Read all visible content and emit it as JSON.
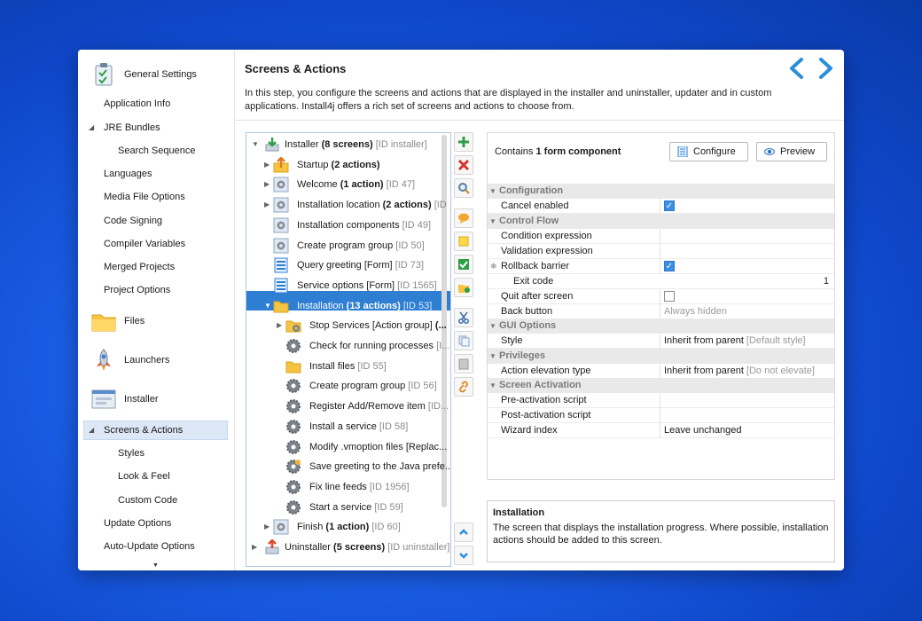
{
  "header": {
    "title": "Screens & Actions",
    "description": "In this step, you configure the screens and actions that are displayed in the installer and uninstaller, updater and in custom applications. Install4j offers a rich set of screens and actions to choose from."
  },
  "sidebar": {
    "sections": [
      {
        "label": "General Settings"
      },
      {
        "label": "Files"
      },
      {
        "label": "Launchers"
      },
      {
        "label": "Installer"
      }
    ],
    "items": [
      {
        "label": "Application Info"
      },
      {
        "label": "JRE Bundles"
      },
      {
        "label": "Search Sequence"
      },
      {
        "label": "Languages"
      },
      {
        "label": "Media File Options"
      },
      {
        "label": "Code Signing"
      },
      {
        "label": "Compiler Variables"
      },
      {
        "label": "Merged Projects"
      },
      {
        "label": "Project Options"
      },
      {
        "label": "Screens & Actions"
      },
      {
        "label": "Styles"
      },
      {
        "label": "Look & Feel"
      },
      {
        "label": "Custom Code"
      },
      {
        "label": "Update Options"
      },
      {
        "label": "Auto-Update Options"
      }
    ]
  },
  "tree": {
    "rows": [
      {
        "pre": "Installer ",
        "bold": "(8 screens)",
        "id": " [ID installer]"
      },
      {
        "pre": "Startup ",
        "bold": "(2 actions)",
        "id": ""
      },
      {
        "pre": "Welcome ",
        "bold": "(1 action)",
        "id": " [ID 47]"
      },
      {
        "pre": "Installation location ",
        "bold": "(2 actions)",
        "id": " [ID"
      },
      {
        "pre": "Installation components",
        "bold": "",
        "id": " [ID 49]"
      },
      {
        "pre": "Create program group",
        "bold": "",
        "id": " [ID 50]"
      },
      {
        "pre": "Query greeting [Form]",
        "bold": "",
        "id": " [ID 73]"
      },
      {
        "pre": "Service options [Form]",
        "bold": "",
        "id": " [ID 1565]"
      },
      {
        "pre": "Installation ",
        "bold": "(13 actions)",
        "id": " [ID 53]"
      },
      {
        "pre": "Stop Services [Action group] ",
        "bold": "(...",
        "id": ""
      },
      {
        "pre": "Check for running processes",
        "bold": "",
        "id": " [I..."
      },
      {
        "pre": "Install files",
        "bold": "",
        "id": " [ID 55]"
      },
      {
        "pre": "Create program group",
        "bold": "",
        "id": " [ID 56]"
      },
      {
        "pre": "Register Add/Remove item",
        "bold": "",
        "id": " [ID..."
      },
      {
        "pre": "Install a service",
        "bold": "",
        "id": " [ID 58]"
      },
      {
        "pre": "Modify .vmoption files [Replac...",
        "bold": "",
        "id": ""
      },
      {
        "pre": "Save greeting to the Java prefe...",
        "bold": "",
        "id": ""
      },
      {
        "pre": "Fix line feeds",
        "bold": "",
        "id": " [ID 1956]"
      },
      {
        "pre": "Start a service",
        "bold": "",
        "id": " [ID 59]"
      },
      {
        "pre": "Finish ",
        "bold": "(1 action)",
        "id": " [ID 60]"
      },
      {
        "pre": "Uninstaller ",
        "bold": "(5 screens)",
        "id": " [ID uninstaller]"
      }
    ]
  },
  "props": {
    "contains_pre": "Contains ",
    "contains_bold": "1 form component",
    "configure_label": "Configure",
    "preview_label": "Preview",
    "sections": {
      "configuration": "Configuration",
      "control_flow": "Control Flow",
      "gui_options": "GUI Options",
      "privileges": "Privileges",
      "screen_activation": "Screen Activation"
    },
    "rows": {
      "cancel_enabled": {
        "name": "Cancel enabled",
        "checked": true
      },
      "condition_expression": {
        "name": "Condition expression",
        "value": ""
      },
      "validation_expression": {
        "name": "Validation expression",
        "value": ""
      },
      "rollback_barrier": {
        "name": "Rollback barrier",
        "checked": true
      },
      "exit_code": {
        "name": "Exit code",
        "value": "1"
      },
      "quit_after_screen": {
        "name": "Quit after screen",
        "checked": false
      },
      "back_button": {
        "name": "Back button",
        "value": "Always hidden"
      },
      "style": {
        "name": "Style",
        "value": "Inherit from parent",
        "hint": " [Default style]"
      },
      "action_elevation_type": {
        "name": "Action elevation type",
        "value": "Inherit from parent",
        "hint": " [Do not elevate]"
      },
      "pre_activation_script": {
        "name": "Pre-activation script",
        "value": ""
      },
      "post_activation_script": {
        "name": "Post-activation script",
        "value": ""
      },
      "wizard_index": {
        "name": "Wizard index",
        "value": "Leave unchanged"
      }
    }
  },
  "description_box": {
    "title": "Installation",
    "text": "The screen that displays the installation progress. Where possible, installation actions should be added to this screen."
  },
  "colors": {
    "accent": "#2e7fd3",
    "arrow": "#2b8fd9",
    "desktop": "#1b5fe8"
  }
}
